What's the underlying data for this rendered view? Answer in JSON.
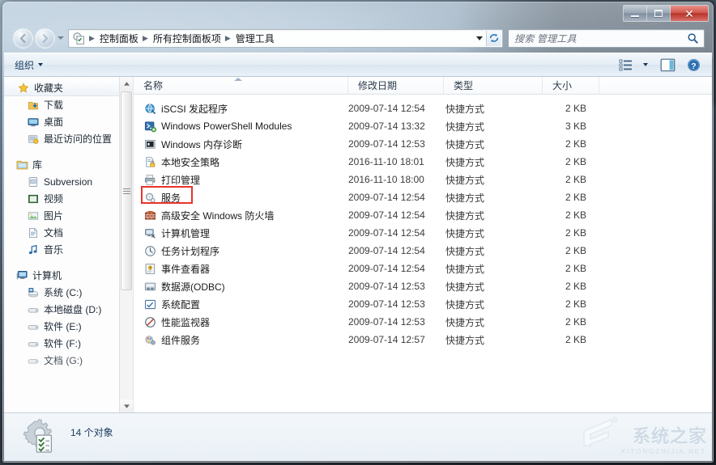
{
  "window": {
    "controls": {
      "minimize": "最小化",
      "maximize": "最大化",
      "close": "关闭"
    }
  },
  "nav_bar": {
    "back_label": "后退",
    "forward_label": "前进",
    "recent_pages_label": "最近浏览的页面",
    "breadcrumb": [
      "控制面板",
      "所有控制面板项",
      "管理工具"
    ],
    "breadcrumb_separator": "▶",
    "dropdown_label": "以前的位置",
    "refresh_label": "刷新"
  },
  "search": {
    "placeholder": "搜索 管理工具",
    "icon": "search-icon"
  },
  "toolbar": {
    "organize_label": "组织",
    "view_label": "更改您的视图",
    "preview_label": "显示预览窗格",
    "help_label": "获取帮助"
  },
  "sidebar": {
    "groups": [
      {
        "header": "收藏夹",
        "header_icon": "star-icon",
        "items": [
          {
            "label": "下载",
            "icon": "downloads-icon"
          },
          {
            "label": "桌面",
            "icon": "desktop-icon"
          },
          {
            "label": "最近访问的位置",
            "icon": "recent-places-icon"
          }
        ]
      },
      {
        "header": "库",
        "header_icon": "library-icon",
        "items": [
          {
            "label": "Subversion",
            "icon": "subversion-icon"
          },
          {
            "label": "视频",
            "icon": "videos-icon"
          },
          {
            "label": "图片",
            "icon": "pictures-icon"
          },
          {
            "label": "文档",
            "icon": "documents-icon"
          },
          {
            "label": "音乐",
            "icon": "music-icon"
          }
        ]
      },
      {
        "header": "计算机",
        "header_icon": "computer-icon",
        "items": [
          {
            "label": "系统 (C:)",
            "icon": "system-drive-icon"
          },
          {
            "label": "本地磁盘 (D:)",
            "icon": "drive-icon"
          },
          {
            "label": "软件 (E:)",
            "icon": "drive-icon"
          },
          {
            "label": "软件 (F:)",
            "icon": "drive-icon"
          },
          {
            "label": "文档 (G:)",
            "icon": "drive-icon"
          }
        ]
      }
    ],
    "scrollbar": {
      "up": "向上滚动",
      "down": "向下滚动"
    }
  },
  "file_list": {
    "columns": [
      {
        "key": "name",
        "label": "名称",
        "sorted": true
      },
      {
        "key": "date",
        "label": "修改日期",
        "sorted": false
      },
      {
        "key": "type",
        "label": "类型",
        "sorted": false
      },
      {
        "key": "size",
        "label": "大小",
        "sorted": false
      }
    ],
    "rows": [
      {
        "name": "iSCSI 发起程序",
        "date": "2009-07-14 12:54",
        "type": "快捷方式",
        "size": "2 KB",
        "icon": "iscsi-icon",
        "highlighted": false
      },
      {
        "name": "Windows PowerShell Modules",
        "date": "2009-07-14 13:32",
        "type": "快捷方式",
        "size": "3 KB",
        "icon": "powershell-icon",
        "highlighted": false
      },
      {
        "name": "Windows 内存诊断",
        "date": "2009-07-14 12:53",
        "type": "快捷方式",
        "size": "2 KB",
        "icon": "memory-diagnostic-icon",
        "highlighted": false
      },
      {
        "name": "本地安全策略",
        "date": "2016-11-10 18:01",
        "type": "快捷方式",
        "size": "2 KB",
        "icon": "local-security-policy-icon",
        "highlighted": false
      },
      {
        "name": "打印管理",
        "date": "2016-11-10 18:00",
        "type": "快捷方式",
        "size": "2 KB",
        "icon": "print-management-icon",
        "highlighted": false
      },
      {
        "name": "服务",
        "date": "2009-07-14 12:54",
        "type": "快捷方式",
        "size": "2 KB",
        "icon": "services-icon",
        "highlighted": true
      },
      {
        "name": "高级安全 Windows 防火墙",
        "date": "2009-07-14 12:54",
        "type": "快捷方式",
        "size": "2 KB",
        "icon": "firewall-icon",
        "highlighted": false
      },
      {
        "name": "计算机管理",
        "date": "2009-07-14 12:54",
        "type": "快捷方式",
        "size": "2 KB",
        "icon": "computer-management-icon",
        "highlighted": false
      },
      {
        "name": "任务计划程序",
        "date": "2009-07-14 12:54",
        "type": "快捷方式",
        "size": "2 KB",
        "icon": "task-scheduler-icon",
        "highlighted": false
      },
      {
        "name": "事件查看器",
        "date": "2009-07-14 12:54",
        "type": "快捷方式",
        "size": "2 KB",
        "icon": "event-viewer-icon",
        "highlighted": false
      },
      {
        "name": "数据源(ODBC)",
        "date": "2009-07-14 12:53",
        "type": "快捷方式",
        "size": "2 KB",
        "icon": "odbc-icon",
        "highlighted": false
      },
      {
        "name": "系统配置",
        "date": "2009-07-14 12:53",
        "type": "快捷方式",
        "size": "2 KB",
        "icon": "system-config-icon",
        "highlighted": false
      },
      {
        "name": "性能监视器",
        "date": "2009-07-14 12:53",
        "type": "快捷方式",
        "size": "2 KB",
        "icon": "performance-monitor-icon",
        "highlighted": false
      },
      {
        "name": "组件服务",
        "date": "2009-07-14 12:57",
        "type": "快捷方式",
        "size": "2 KB",
        "icon": "component-services-icon",
        "highlighted": false
      }
    ]
  },
  "status_bar": {
    "count_text": "14 个对象",
    "icon": "admin-tools-icon"
  },
  "watermark": {
    "chinese": "系统之家",
    "english": "XITONGZHIJIA.NET"
  },
  "colors": {
    "highlight_red": "#e8342a",
    "breadcrumb_text": "#13171b",
    "toolbar_text": "#15385f",
    "close_button": "#c0392b"
  }
}
